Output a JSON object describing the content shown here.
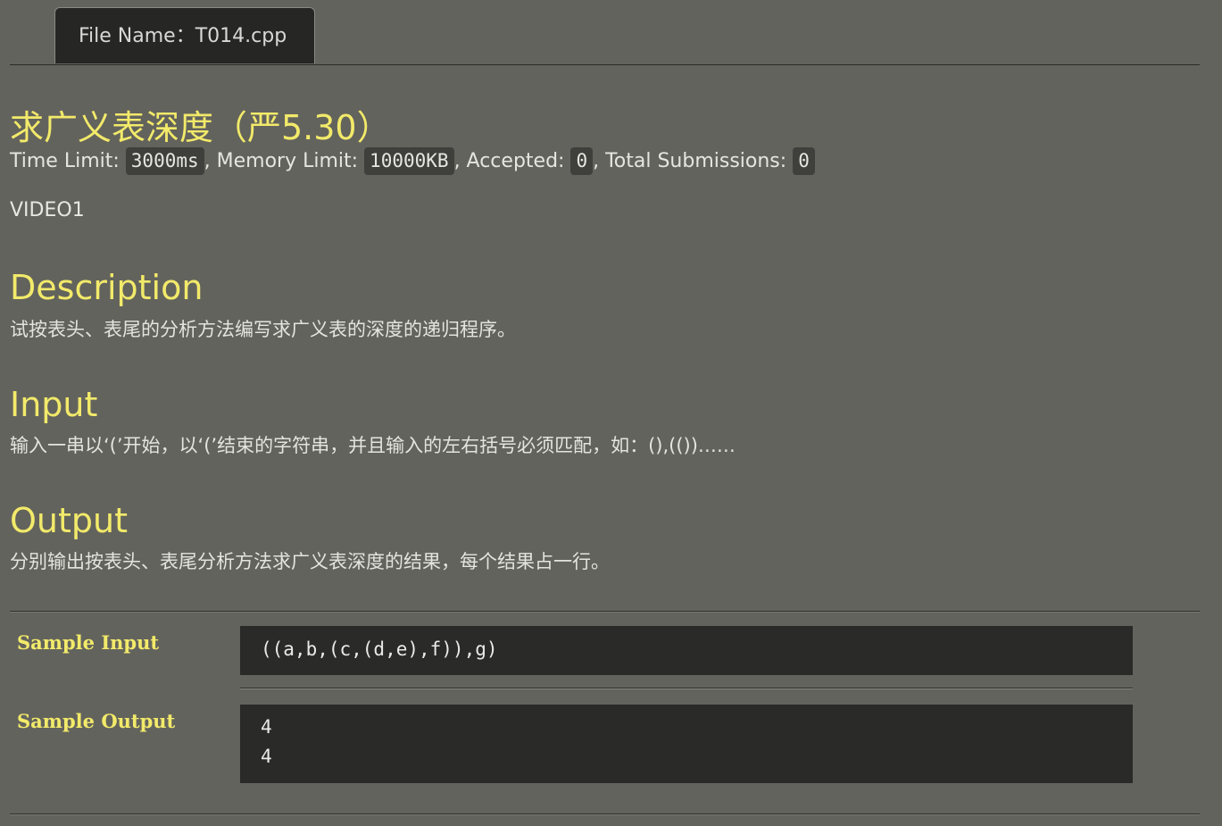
{
  "tab": {
    "label": "File Name：T014.cpp"
  },
  "problem": {
    "title": "求广义表深度（严5.30）",
    "limits": {
      "time_label": "Time Limit: ",
      "time_value": "3000ms",
      "memory_label": ", Memory Limit: ",
      "memory_value": "10000KB",
      "accepted_label": ", Accepted: ",
      "accepted_value": "0",
      "submissions_label": ", Total Submissions: ",
      "submissions_value": "0"
    },
    "video": "VIDEO1",
    "description": {
      "heading": "Description",
      "text": "试按表头、表尾的分析方法编写求广义表的深度的递归程序。"
    },
    "input": {
      "heading": "Input",
      "text": "输入一串以‘(’开始，以‘(’结束的字符串，并且输入的左右括号必须匹配，如：(),(())……"
    },
    "output": {
      "heading": "Output",
      "text": "分别输出按表头、表尾分析方法求广义表深度的结果，每个结果占一行。"
    }
  },
  "samples": {
    "input_label": "Sample Input",
    "input_lines": [
      "((a,b,(c,(d,e),f)),g)"
    ],
    "output_label": "Sample Output",
    "output_lines": [
      "4",
      "4"
    ]
  }
}
